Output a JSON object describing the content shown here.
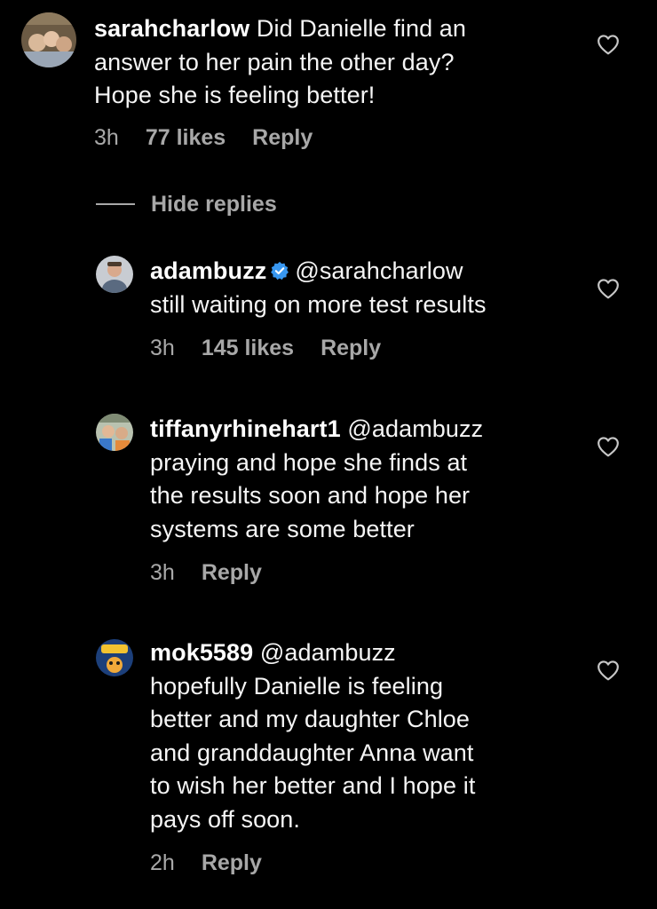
{
  "comments": [
    {
      "username": "sarahcharlow",
      "text": "Did Danielle find an answer to her pain the other day? Hope she is feeling better!",
      "text_lines": [
        "Did Danielle find an",
        "answer to her pain the other day?",
        "Hope she is feeling better!"
      ],
      "time": "3h",
      "likes": "77 likes",
      "reply": "Reply"
    },
    {
      "username": "adambuzz",
      "mention": "@sarahcharlow",
      "text_lines": [
        "still waiting on more test results"
      ],
      "time": "3h",
      "likes": "145 likes",
      "reply": "Reply"
    },
    {
      "username": "tiffanyrhinehart1",
      "mention": "@adambuzz",
      "text_lines": [
        "praying and hope she finds at",
        "the results soon and hope her",
        "systems are some better"
      ],
      "time": "3h",
      "reply": "Reply"
    },
    {
      "username": "mok5589",
      "mention": "@adambuzz",
      "text_lines": [
        "hopefully Danielle is feeling",
        "better and my daughter Chloe",
        "and granddaughter Anna want",
        "to wish her better and I hope it",
        "pays off soon."
      ],
      "time": "2h",
      "reply": "Reply"
    }
  ],
  "hide_replies": "Hide replies",
  "icons": {
    "like": "heart-outline-icon",
    "verified": "verified-badge-icon"
  },
  "colors": {
    "background": "#000000",
    "text": "#ffffff",
    "meta": "#a8a8a8",
    "verified": "#3897f0"
  }
}
